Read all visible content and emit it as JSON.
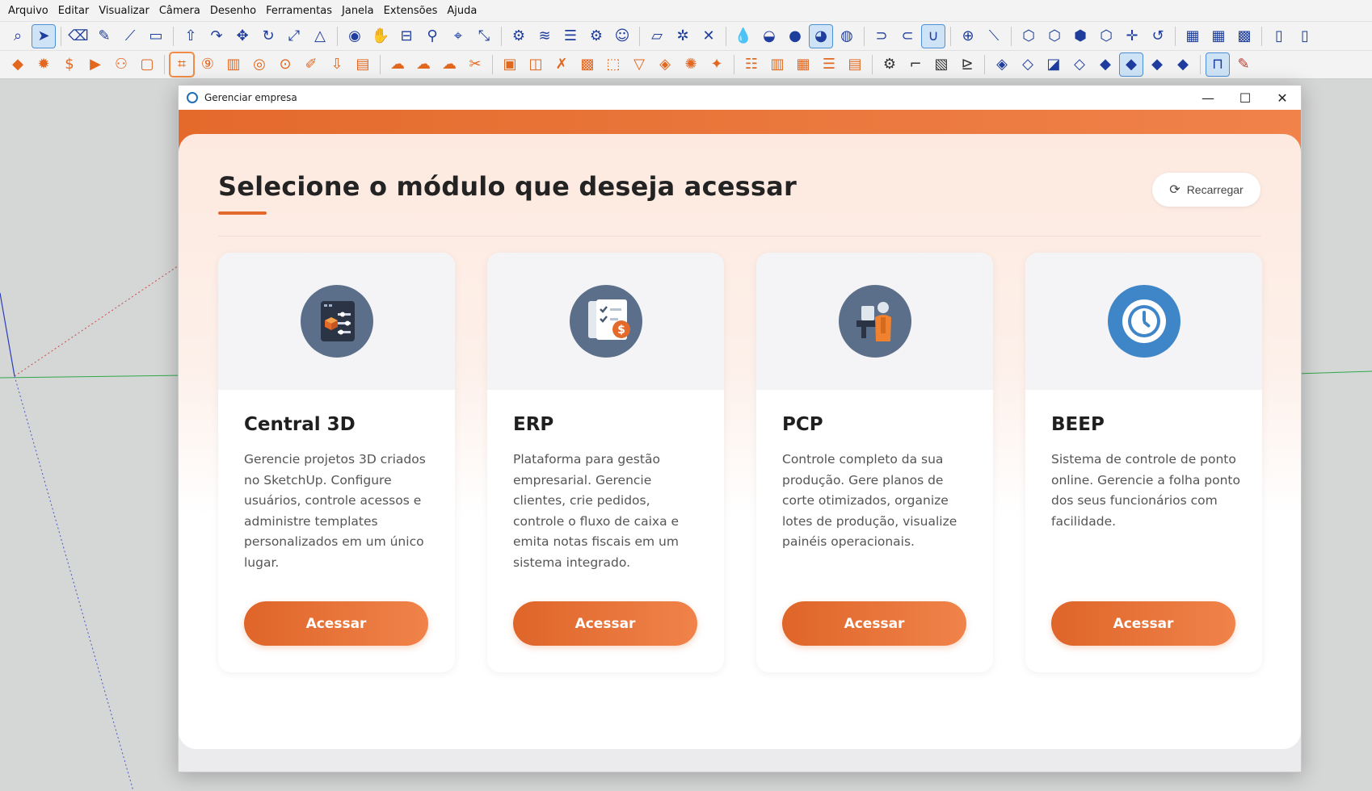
{
  "menubar": {
    "items": [
      "Arquivo",
      "Editar",
      "Visualizar",
      "Câmera",
      "Desenho",
      "Ferramentas",
      "Janela",
      "Extensões",
      "Ajuda"
    ]
  },
  "toolbar1": {
    "icons": [
      "zoom-icon",
      "select-icon",
      "eraser-icon",
      "pencil-icon",
      "line-icon",
      "rectangle-icon",
      "push-pull-icon",
      "follow-me-icon",
      "move-icon",
      "rotate-icon",
      "scale-icon",
      "tape-measure-icon",
      "orbit-icon",
      "pan-icon",
      "section-plane-icon",
      "walk-icon",
      "look-around-icon",
      "zoom-extents-icon",
      "settings-icon",
      "layers-icon",
      "stack-icon",
      "gear-icon",
      "close-icon",
      "drop-icon",
      "add-icon",
      "folder-icon"
    ]
  },
  "toolbar2": {
    "icons": [
      "cube-icon",
      "gear-icon",
      "price-icon",
      "play-icon",
      "user-icon",
      "chat-icon",
      "frame-icon",
      "rotate90-icon",
      "grid-icon",
      "eye-icon",
      "target-icon",
      "brush-icon",
      "download-icon",
      "clipboard-icon",
      "cloud-icon",
      "cloud-sync-icon",
      "image-icon",
      "tools-icon",
      "camera-icon",
      "box-icon",
      "funnel-icon",
      "layers-icon",
      "palette-icon",
      "cursor-icon",
      "grid-table-icon",
      "settings-icon",
      "block-icon",
      "sofa-icon",
      "edit-icon"
    ]
  },
  "dialog": {
    "title": "Gerenciar empresa",
    "heading": "Selecione o módulo que deseja acessar",
    "reload_label": "Recarregar",
    "minimize": "—",
    "maximize": "☐",
    "close": "✕"
  },
  "modules": [
    {
      "name": "Central 3D",
      "description": "Gerencie projetos 3D criados no SketchUp. Configure usuários, controle acessos e administre templates personalizados em um único lugar.",
      "button": "Acessar",
      "icon": "settings-panel-icon",
      "icon_color": "#5b6f8a"
    },
    {
      "name": "ERP",
      "description": "Plataforma para gestão empresarial. Gerencie clientes, crie pedidos, controle o fluxo de caixa e emita notas fiscais em um sistema integrado.",
      "button": "Acessar",
      "icon": "checklist-money-icon",
      "icon_color": "#5b6f8a"
    },
    {
      "name": "PCP",
      "description": "Controle completo da sua produção. Gere planos de corte otimizados, organize lotes de produção, visualize painéis operacionais.",
      "button": "Acessar",
      "icon": "worker-icon",
      "icon_color": "#5b6f8a"
    },
    {
      "name": "BEEP",
      "description": "Sistema de controle de ponto online. Gerencie a folha ponto dos seus funcionários com facilidade.",
      "button": "Acessar",
      "icon": "clock-icon",
      "icon_color": "#3f86c9"
    }
  ],
  "colors": {
    "accent": "#e46a2c",
    "accent_light": "#f0834a"
  }
}
